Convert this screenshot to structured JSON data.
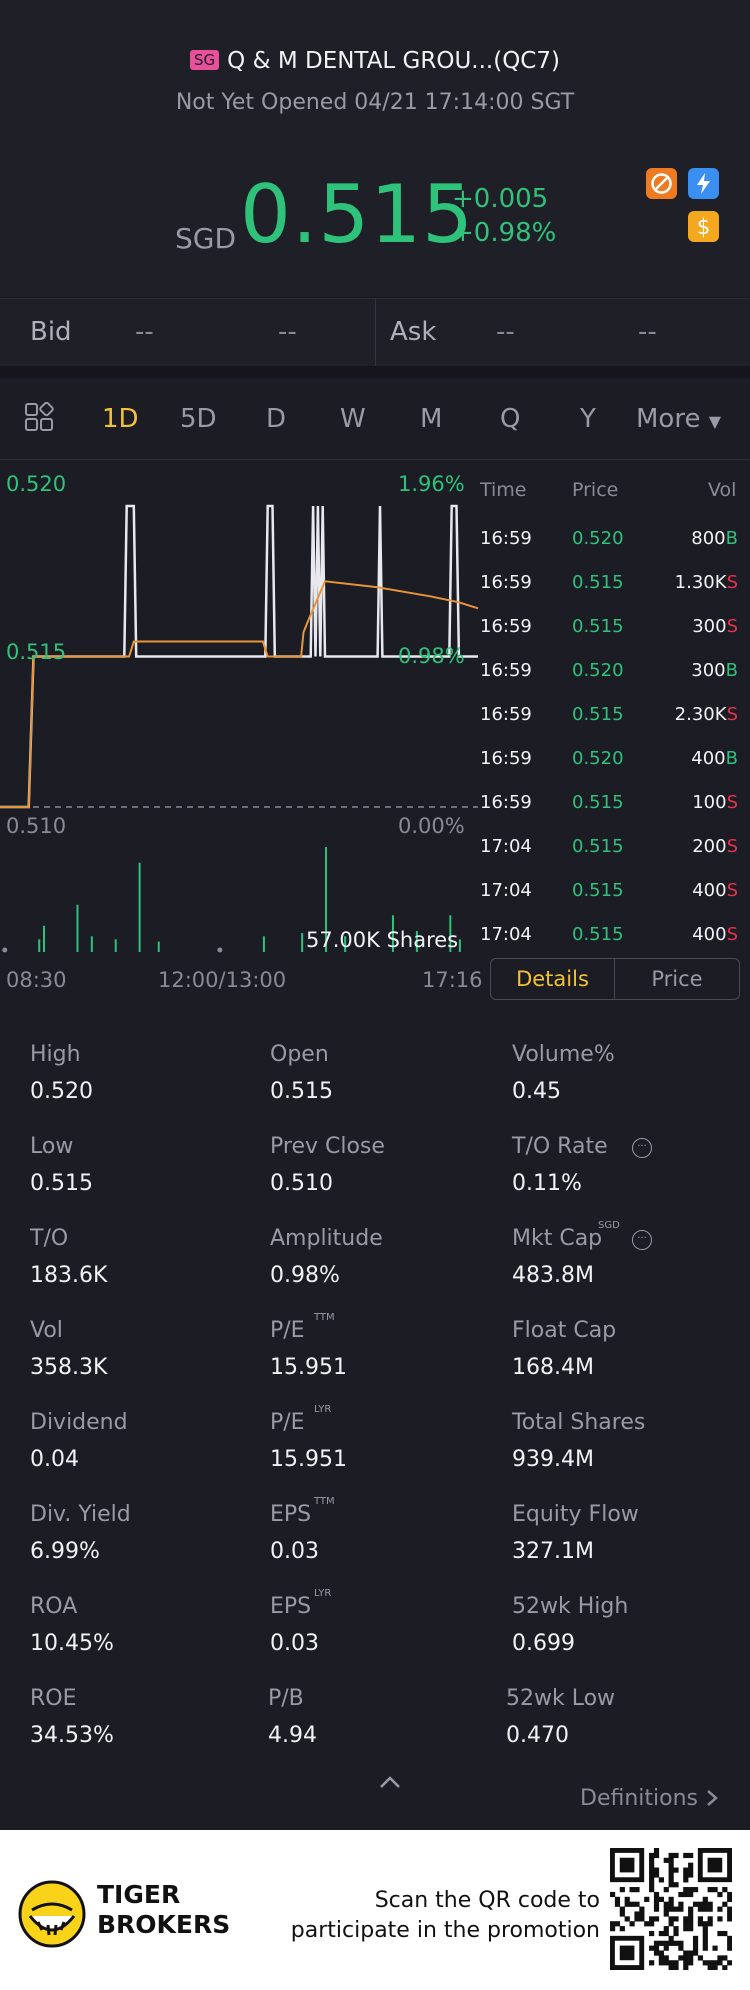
{
  "header": {
    "market_badge": "SG",
    "stock_name": "Q & M DENTAL GROU...(QC7)",
    "status": "Not Yet Opened 04/21 17:14:00 SGT",
    "currency": "SGD",
    "price": "0.515",
    "change": "+0.005",
    "change_pct": "+0.98%",
    "icons": [
      "no-short-icon",
      "flash-icon",
      "dollar-icon"
    ]
  },
  "quote": {
    "bid_label": "Bid",
    "bid_price": "--",
    "bid_size": "--",
    "ask_label": "Ask",
    "ask_price": "--",
    "ask_size": "--"
  },
  "tabs": [
    "1D",
    "5D",
    "D",
    "W",
    "M",
    "Q",
    "Y",
    "More"
  ],
  "active_tab": "1D",
  "chart_data": {
    "type": "line",
    "y_left_labels": [
      "0.520",
      "0.515",
      "0.510"
    ],
    "y_right_labels": [
      "1.96%",
      "0.98%",
      "0.00%"
    ],
    "x_labels": [
      "08:30",
      "12:00/13:00",
      "17:16"
    ],
    "ylim": [
      0.51,
      0.52
    ],
    "prev_close": 0.51,
    "volume_label": "57.00K Shares",
    "series": [
      {
        "type": "line",
        "color": "#e8e8ee",
        "points": [
          [
            0,
            0.51
          ],
          [
            0.06,
            0.51
          ],
          [
            0.07,
            0.515
          ],
          [
            0.26,
            0.515
          ],
          [
            0.265,
            0.52
          ],
          [
            0.28,
            0.52
          ],
          [
            0.285,
            0.515
          ],
          [
            0.555,
            0.515
          ],
          [
            0.56,
            0.52
          ],
          [
            0.57,
            0.52
          ],
          [
            0.575,
            0.515
          ],
          [
            0.65,
            0.515
          ],
          [
            0.655,
            0.52
          ],
          [
            0.66,
            0.515
          ],
          [
            0.665,
            0.52
          ],
          [
            0.67,
            0.515
          ],
          [
            0.675,
            0.52
          ],
          [
            0.68,
            0.515
          ],
          [
            0.79,
            0.515
          ],
          [
            0.795,
            0.52
          ],
          [
            0.8,
            0.515
          ],
          [
            0.94,
            0.515
          ],
          [
            0.945,
            0.52
          ],
          [
            0.955,
            0.52
          ],
          [
            0.96,
            0.515
          ],
          [
            1,
            0.515
          ]
        ]
      },
      {
        "type": "line",
        "color": "#e8953a",
        "points": [
          [
            0,
            0.51
          ],
          [
            0.06,
            0.51
          ],
          [
            0.07,
            0.515
          ],
          [
            0.27,
            0.515
          ],
          [
            0.28,
            0.5155
          ],
          [
            0.55,
            0.5155
          ],
          [
            0.56,
            0.515
          ],
          [
            0.63,
            0.515
          ],
          [
            0.635,
            0.5158
          ],
          [
            0.645,
            0.5162
          ],
          [
            0.68,
            0.5175
          ],
          [
            0.79,
            0.5173
          ],
          [
            0.9,
            0.517
          ],
          [
            0.96,
            0.5168
          ],
          [
            1,
            0.5166
          ]
        ]
      }
    ],
    "volume_bars": [
      [
        0.08,
        0.12
      ],
      [
        0.09,
        0.25
      ],
      [
        0.16,
        0.45
      ],
      [
        0.19,
        0.15
      ],
      [
        0.24,
        0.12
      ],
      [
        0.29,
        0.85
      ],
      [
        0.33,
        0.1
      ],
      [
        0.55,
        0.15
      ],
      [
        0.63,
        0.18
      ],
      [
        0.68,
        1.0
      ],
      [
        0.72,
        0.15
      ],
      [
        0.82,
        0.35
      ],
      [
        0.87,
        0.2
      ],
      [
        0.94,
        0.35
      ],
      [
        0.96,
        0.12
      ]
    ]
  },
  "trades": {
    "headers": {
      "time": "Time",
      "price": "Price",
      "vol": "Vol"
    },
    "rows": [
      {
        "time": "16:59",
        "price": "0.520",
        "vol": "800",
        "side": "B"
      },
      {
        "time": "16:59",
        "price": "0.515",
        "vol": "1.30K",
        "side": "S"
      },
      {
        "time": "16:59",
        "price": "0.515",
        "vol": "300",
        "side": "S"
      },
      {
        "time": "16:59",
        "price": "0.520",
        "vol": "300",
        "side": "B"
      },
      {
        "time": "16:59",
        "price": "0.515",
        "vol": "2.30K",
        "side": "S"
      },
      {
        "time": "16:59",
        "price": "0.520",
        "vol": "400",
        "side": "B"
      },
      {
        "time": "16:59",
        "price": "0.515",
        "vol": "100",
        "side": "S"
      },
      {
        "time": "17:04",
        "price": "0.515",
        "vol": "200",
        "side": "S"
      },
      {
        "time": "17:04",
        "price": "0.515",
        "vol": "400",
        "side": "S"
      },
      {
        "time": "17:04",
        "price": "0.515",
        "vol": "400",
        "side": "S"
      }
    ]
  },
  "toggle": {
    "details": "Details",
    "price": "Price"
  },
  "stats": [
    [
      {
        "label": "High",
        "value": "0.520"
      },
      {
        "label": "Open",
        "value": "0.515"
      },
      {
        "label": "Volume%",
        "value": "0.45"
      }
    ],
    [
      {
        "label": "Low",
        "value": "0.515"
      },
      {
        "label": "Prev Close",
        "value": "0.510"
      },
      {
        "label": "T/O Rate",
        "value": "0.11%",
        "info": true
      }
    ],
    [
      {
        "label": "T/O",
        "value": "183.6K"
      },
      {
        "label": "Amplitude",
        "value": "0.98%"
      },
      {
        "label": "Mkt Cap",
        "value": "483.8M",
        "sup": "SGD",
        "info": true
      }
    ],
    [
      {
        "label": "Vol",
        "value": "358.3K"
      },
      {
        "label": "P/E",
        "value": "15.951",
        "sup": "TTM"
      },
      {
        "label": "Float Cap",
        "value": "168.4M"
      }
    ],
    [
      {
        "label": "Dividend",
        "value": "0.04"
      },
      {
        "label": "P/E",
        "value": "15.951",
        "sup": "LYR"
      },
      {
        "label": "Total Shares",
        "value": "939.4M"
      }
    ],
    [
      {
        "label": "Div. Yield",
        "value": "6.99%"
      },
      {
        "label": "EPS",
        "value": "0.03",
        "sup": "TTM"
      },
      {
        "label": "Equity Flow",
        "value": "327.1M"
      }
    ],
    [
      {
        "label": "ROA",
        "value": "10.45%"
      },
      {
        "label": "EPS",
        "value": "0.03",
        "sup": "LYR"
      },
      {
        "label": "52wk High",
        "value": "0.699"
      }
    ],
    [
      {
        "label": "ROE",
        "value": "34.53%"
      },
      {
        "label": "P/B",
        "value": "4.94"
      },
      {
        "label": "52wk Low",
        "value": "0.470"
      }
    ]
  ],
  "definitions_label": "Definitions",
  "footer": {
    "brand_line1": "TIGER",
    "brand_line2": "BROKERS",
    "promo_line1": "Scan the QR code to",
    "promo_line2": "participate in the promotion"
  },
  "colors": {
    "up": "#2fc27a",
    "down": "#e8324a",
    "accent": "#f3c234",
    "bg": "#1c1c24"
  }
}
